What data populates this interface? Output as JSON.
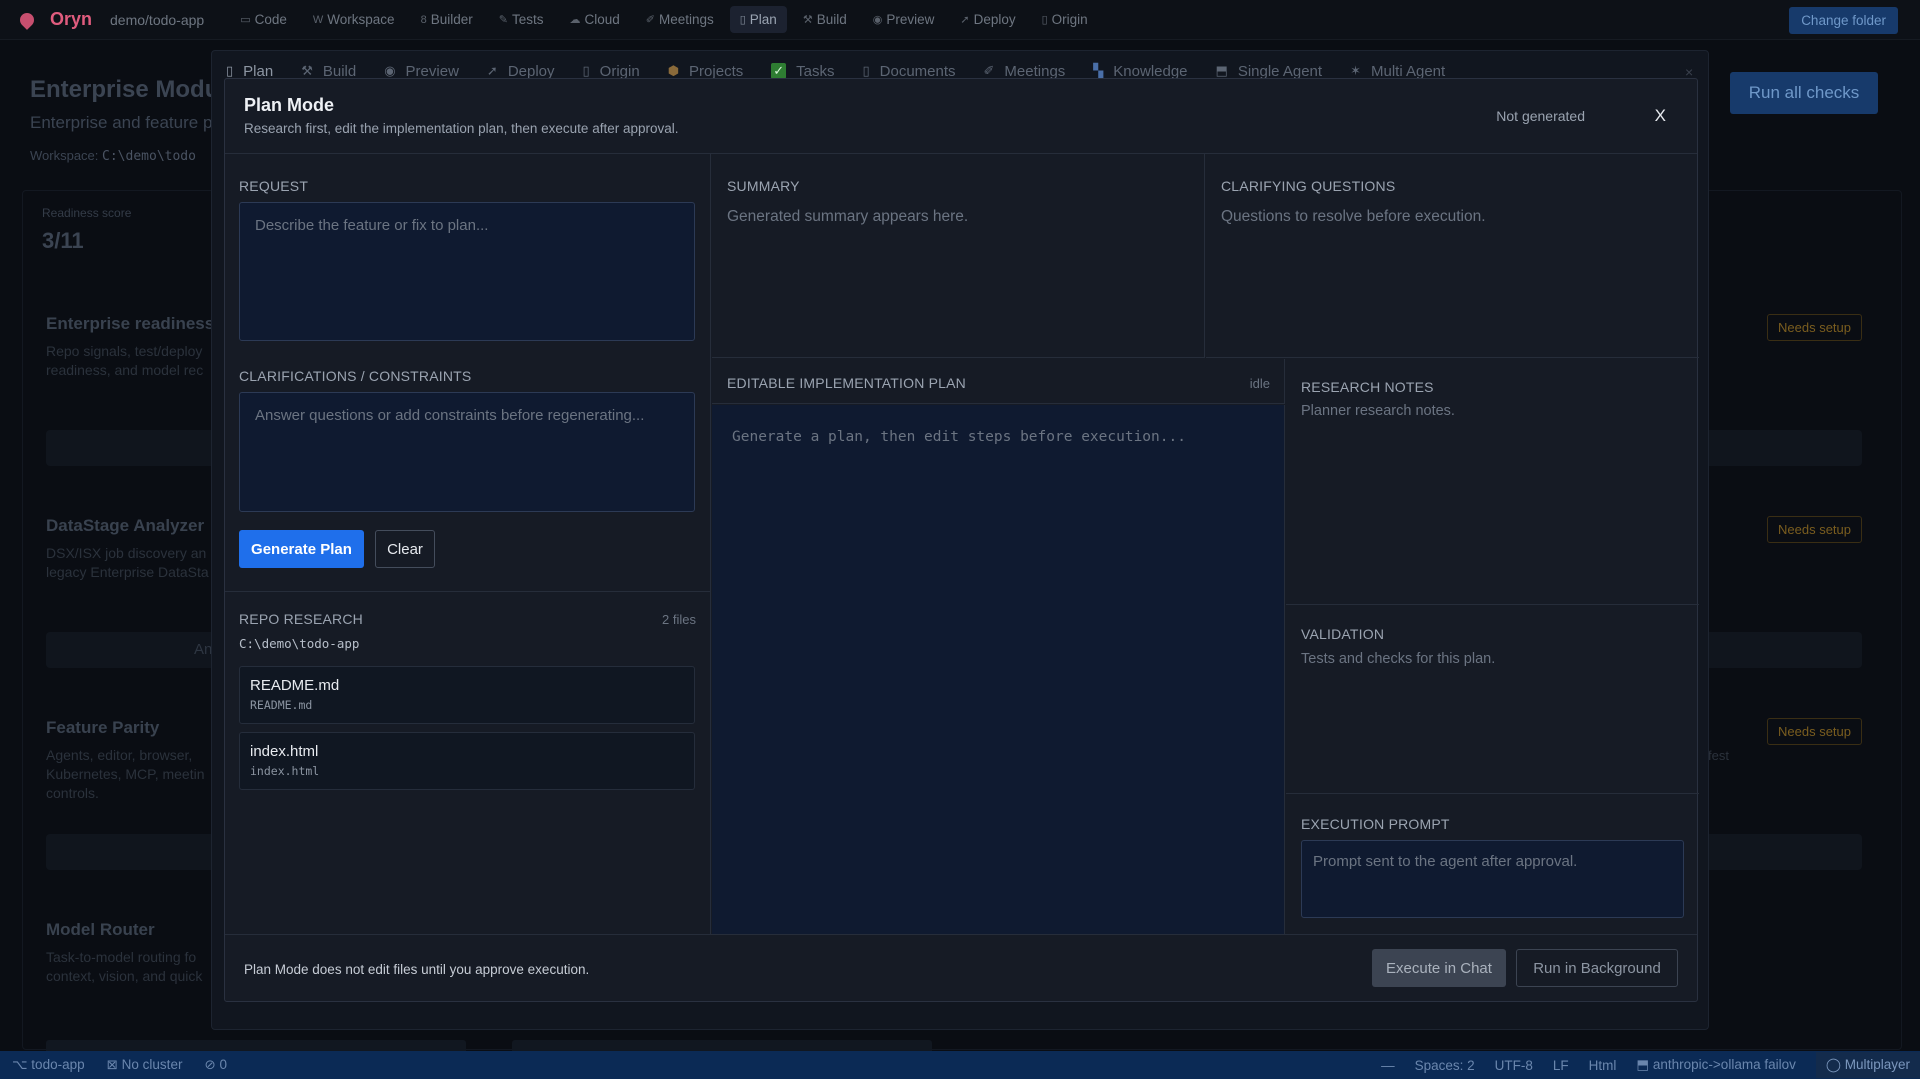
{
  "app": {
    "name": "Oryn",
    "path": "demo/todo-app",
    "change_folder": "Change folder"
  },
  "topnav": [
    {
      "icon": "▭",
      "label": "Code"
    },
    {
      "icon": "W",
      "label": "Workspace"
    },
    {
      "icon": "8",
      "label": "Builder"
    },
    {
      "icon": "✎",
      "label": "Tests"
    },
    {
      "icon": "☁",
      "label": "Cloud"
    },
    {
      "icon": "✐",
      "label": "Meetings"
    },
    {
      "icon": "▯",
      "label": "Plan"
    },
    {
      "icon": "⚒",
      "label": "Build"
    },
    {
      "icon": "◉",
      "label": "Preview"
    },
    {
      "icon": "➚",
      "label": "Deploy"
    },
    {
      "icon": "▯",
      "label": "Origin"
    }
  ],
  "background": {
    "title": "Enterprise Modu",
    "subtitle": "Enterprise and feature p",
    "workspace_label": "Workspace:",
    "workspace_path": "C:\\demo\\todo",
    "run_all": "Run all checks",
    "score_label": "Readiness score",
    "score": "3/11",
    "cards": [
      {
        "title": "Enterprise readiness",
        "desc": "Repo signals, test/deploy readiness, and model rec",
        "badge": "Needs setup"
      },
      {
        "title": "DataStage Analyzer",
        "desc": "DSX/ISX job discovery an legacy Enterprise DataSta",
        "badge": "Needs setup",
        "bar_text": "An"
      },
      {
        "title": "Feature Parity",
        "desc": "Agents, editor, browser, Kubernetes, MCP, meetin controls.",
        "badge": "Needs setup",
        "side_text": "fest"
      },
      {
        "title": "Model Router",
        "desc": "Task-to-model routing fo context, vision, and quick"
      }
    ]
  },
  "outer_tabs": [
    {
      "icon": "▯",
      "label": "Plan"
    },
    {
      "icon": "⚒",
      "label": "Build"
    },
    {
      "icon": "◉",
      "label": "Preview"
    },
    {
      "icon": "➚",
      "label": "Deploy"
    },
    {
      "icon": "▯",
      "label": "Origin"
    },
    {
      "icon": "⬢",
      "label": "Projects"
    },
    {
      "icon": "✓",
      "label": "Tasks"
    },
    {
      "icon": "▯",
      "label": "Documents"
    },
    {
      "icon": "✐",
      "label": "Meetings"
    },
    {
      "icon": "▚",
      "label": "Knowledge"
    },
    {
      "icon": "⬒",
      "label": "Single Agent"
    },
    {
      "icon": "✶",
      "label": "Multi Agent"
    }
  ],
  "outer_close": "×",
  "modal": {
    "title": "Plan Mode",
    "description": "Research first, edit the implementation plan, then execute after approval.",
    "status": "Not generated",
    "close": "X",
    "request": {
      "label": "REQUEST",
      "placeholder": "Describe the feature or fix to plan..."
    },
    "clarifications": {
      "label": "CLARIFICATIONS / CONSTRAINTS",
      "placeholder": "Answer questions or add constraints before regenerating..."
    },
    "generate_button": "Generate Plan",
    "clear_button": "Clear",
    "repo_research": {
      "label": "REPO RESEARCH",
      "count": "2 files",
      "path": "C:\\demo\\todo-app",
      "files": [
        {
          "name": "README.md",
          "path": "README.md"
        },
        {
          "name": "index.html",
          "path": "index.html"
        }
      ]
    },
    "summary": {
      "label": "SUMMARY",
      "text": "Generated summary appears here."
    },
    "clarifying_questions": {
      "label": "CLARIFYING QUESTIONS",
      "text": "Questions to resolve before execution."
    },
    "plan": {
      "label": "EDITABLE IMPLEMENTATION PLAN",
      "status": "idle",
      "placeholder": "Generate a plan, then edit steps before execution..."
    },
    "research_notes": {
      "label": "RESEARCH NOTES",
      "text": "Planner research notes."
    },
    "validation": {
      "label": "VALIDATION",
      "text": "Tests and checks for this plan."
    },
    "execution_prompt": {
      "label": "EXECUTION PROMPT",
      "placeholder": "Prompt sent to the agent after approval."
    },
    "footer_note": "Plan Mode does not edit files until you approve execution.",
    "execute_button": "Execute in Chat",
    "background_button": "Run in Background"
  },
  "statusbar": {
    "branch": "⌥ todo-app",
    "cluster": "⊠ No cluster",
    "problems": "⊘ 0",
    "dash": "—",
    "spaces": "Spaces: 2",
    "encoding": "UTF-8",
    "eol": "LF",
    "language": "Html",
    "model": "⬒ anthropic->ollama failov",
    "multiplayer": "◯ Multiplayer"
  }
}
